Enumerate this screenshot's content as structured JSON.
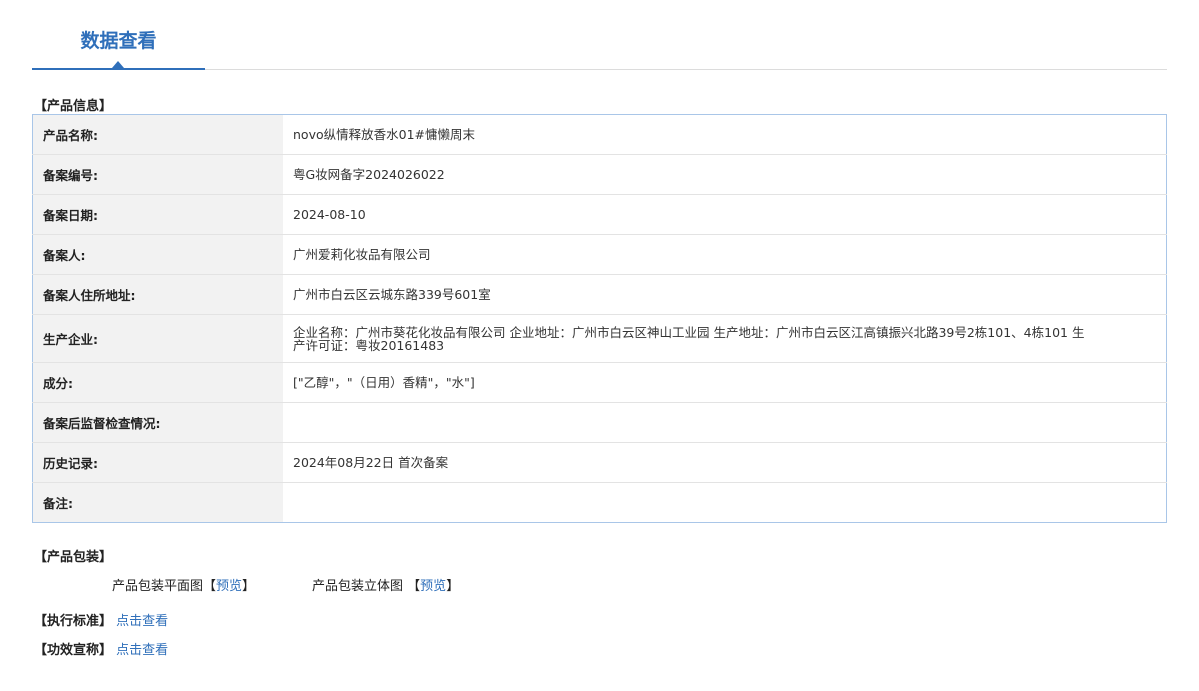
{
  "header": {
    "title": "数据查看"
  },
  "product_info": {
    "section_title": "【产品信息】",
    "rows": [
      {
        "label": "产品名称:",
        "value": "novo纵情释放香水01#慵懒周末"
      },
      {
        "label": "备案编号:",
        "value": "粤G妆网备字2024026022"
      },
      {
        "label": "备案日期:",
        "value": "2024-08-10"
      },
      {
        "label": "备案人:",
        "value": "广州爱莉化妆品有限公司"
      },
      {
        "label": "备案人住所地址:",
        "value": "广州市白云区云城东路339号601室"
      },
      {
        "label": "生产企业:",
        "value": "企业名称：广州市葵花化妆品有限公司 企业地址：广州市白云区神山工业园 生产地址：广州市白云区江高镇振兴北路39号2栋101、4栋101 生产许可证：粤妆20161483"
      },
      {
        "label": "成分:",
        "value": "[\"乙醇\"，\"（日用）香精\"，\"水\"]"
      },
      {
        "label": "备案后监督检查情况:",
        "value": ""
      },
      {
        "label": "历史记录:",
        "value": "2024年08月22日 首次备案"
      },
      {
        "label": "备注:",
        "value": ""
      }
    ]
  },
  "packaging": {
    "section_title": "【产品包装】",
    "flat_label": "产品包装平面图",
    "flat_open": "【",
    "flat_link": "预览",
    "flat_close": "】",
    "stereo_label": "产品包装立体图",
    "stereo_open": "【",
    "stereo_link": "预览",
    "stereo_close": "】"
  },
  "standard": {
    "label": "【执行标准】",
    "link": "点击查看"
  },
  "efficacy": {
    "label": "【功效宣称】",
    "link": "点击查看"
  }
}
